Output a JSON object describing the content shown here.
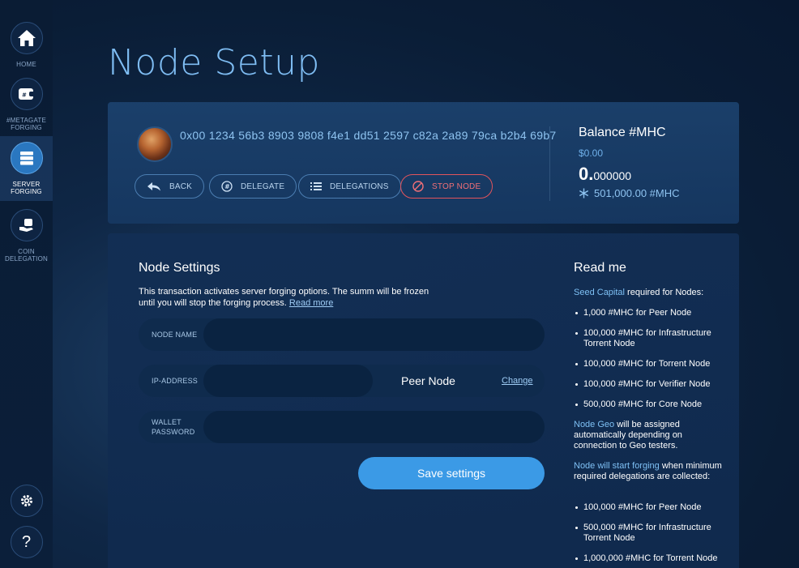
{
  "sidebar": {
    "items": [
      {
        "label": "HOME",
        "icon": "home-icon"
      },
      {
        "label": "#METAGATE FORGING",
        "icon": "wallet-icon"
      },
      {
        "label": "SERVER FORGING",
        "icon": "server-icon",
        "active": true
      },
      {
        "label": "COIN DELEGATION",
        "icon": "coin-hand-icon"
      }
    ],
    "settings_icon": "gear-icon",
    "help_label": "?"
  },
  "page": {
    "title": "Node Setup"
  },
  "header": {
    "address": "0x00 1234 56b3 8903 9808 f4e1 dd51 2597 c82a 2a89 79ca b2b4 69b7",
    "buttons": {
      "back": "BACK",
      "delegate": "DELEGATE",
      "delegations": "DELEGATIONS",
      "stop_node": "STOP NODE"
    },
    "balance": {
      "title": "Balance #MHC",
      "usd": "$0.00",
      "amount_int": "0.",
      "amount_dec": "000000",
      "frozen": "501,000.00 #MHC"
    }
  },
  "settings": {
    "title": "Node Settings",
    "desc": "This transaction activates server forging options. The summ will be frozen until you will stop the forging process.",
    "read_more": "Read more",
    "node_name_label": "NODE NAME",
    "ip_label": "IP-ADDRESS",
    "peer_node": "Peer Node",
    "change": "Change",
    "wallet_label_1": "WALLET",
    "wallet_label_2": "PASSWORD",
    "save": "Save settings"
  },
  "readme": {
    "title": "Read me",
    "seed_hl": "Seed Capital",
    "seed_rest": " required for Nodes:",
    "seed_items": [
      "1,000 #MHC for Peer Node",
      "100,000 #MHC for Infrastructure Torrent Node",
      "100,000 #MHC for Torrent Node",
      "100,000 #MHC for Verifier Node",
      "500,000 #MHC for Core Node"
    ],
    "geo_hl": "Node Geo",
    "geo_rest": " will be assigned automatically depending on connection to Geo testers.",
    "forging_hl": "Node will start forging",
    "forging_rest": " when minimum required delegations are collected:",
    "forging_items": [
      "100,000 #MHC for Peer Node",
      "500,000 #MHC for Infrastructure Torrent Node",
      "1,000,000 #MHC for Torrent Node"
    ]
  }
}
